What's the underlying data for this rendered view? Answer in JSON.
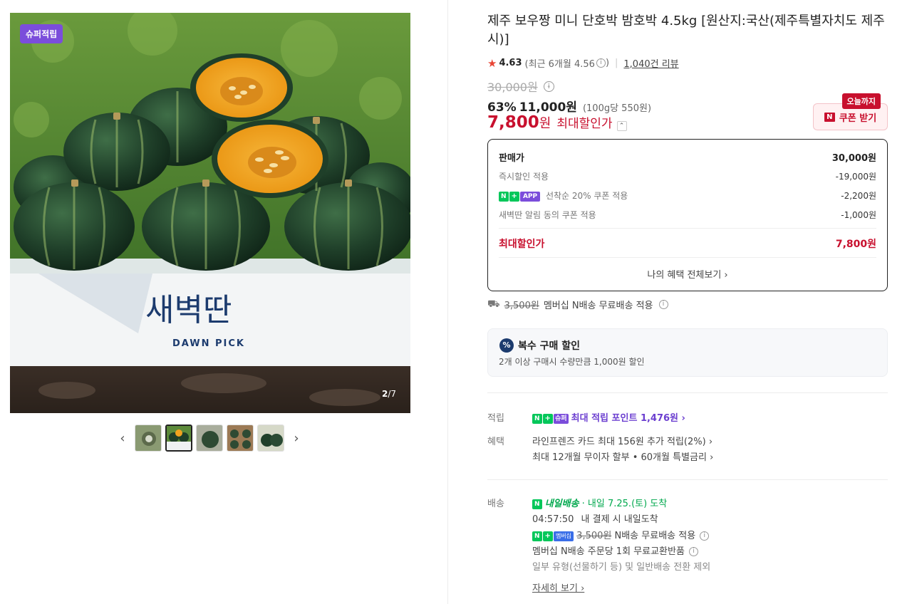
{
  "gallery": {
    "badge": "슈퍼적립",
    "counter_current": "2",
    "counter_total": "/7",
    "brand_korean": "새벽딴",
    "brand_english": "DAWN PICK",
    "prev_icon": "chevron-left-icon",
    "next_icon": "chevron-right-icon",
    "thumb_count": 5,
    "active_thumb": 2
  },
  "product": {
    "title": "제주 보우짱 미니 단호박 밤호박 4.5kg [원산지:국산(제주특별자치도 제주시)]",
    "rating": "4.63",
    "rating_recent": "(최근 6개월 4.56",
    "rating_recent_close": ")",
    "reviews": "1,040건 리뷰",
    "original_price": "30,000원",
    "discount_rate": "63%",
    "sale_price": "11,000원",
    "unit_price": "(100g당 550원)",
    "max_price": "7,800",
    "max_won": "원",
    "max_label": "최대할인가"
  },
  "coupon": {
    "today_badge": "오늘까지",
    "button_label": "쿠폰 받기",
    "n_mark": "N"
  },
  "breakdown": {
    "head_label": "판매가",
    "head_value": "30,000원",
    "rows": [
      {
        "label": "즉시할인 적용",
        "value": "-19,000원"
      },
      {
        "label": "선착순 20% 쿠폰 적용",
        "value": "-2,200원"
      },
      {
        "label": "새벽딴 알림 동의 쿠폰 적용",
        "value": "-1,000원"
      }
    ],
    "max_label": "최대할인가",
    "max_value": "7,800원",
    "more_link": "나의 혜택 전체보기 ›",
    "tag_n": "N",
    "tag_plus": "+",
    "tag_app": "APP"
  },
  "shipping_summary": {
    "fee": "3,500원",
    "text": "멤버십 N배송 무료배송 적용"
  },
  "multi": {
    "icon": "%",
    "title": "복수 구매 할인",
    "desc": "2개 이상 구매시 수량만큼 1,000원 할인"
  },
  "points": {
    "label": "적립",
    "tag_super": "슈퍼",
    "text": "최대 적립 포인트 1,476원 ›"
  },
  "benefits": {
    "label": "혜택",
    "line1": "라인프렌즈 카드 최대 156원 추가 적립(2%) ›",
    "line2": "최대 12개월 무이자 할부 • 60개월 특별금리 ›"
  },
  "delivery": {
    "label": "배송",
    "brand": "내일배송",
    "arrival": "· 내일 7.25.(토) 도착",
    "countdown": "04:57:50",
    "countdown_text": "내 결제 시 내일도착",
    "tag_member": "멤버십",
    "fee": "3,500원",
    "fee_text": "N배송 무료배송 적용",
    "exchange": "멤버십 N배송 주문당 1회 무료교환반품",
    "exclude": "일부 유형(선물하기 등) 및 일반배송 전환 제외",
    "detail_link": "자세히 보기 ›"
  },
  "colors": {
    "accent_red": "#c8102e",
    "naver_green": "#03c75a",
    "super_purple": "#7b4ddb"
  }
}
